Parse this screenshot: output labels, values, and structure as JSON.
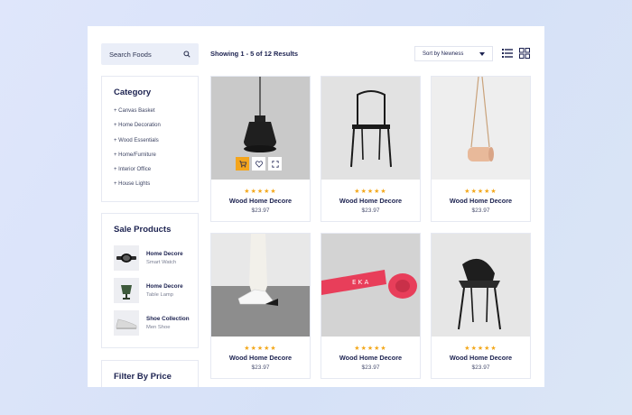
{
  "search": {
    "label": "Search Foods"
  },
  "category": {
    "title": "Category",
    "items": [
      "+ Canvas Basket",
      "+ Home Decoration",
      "+ Wood Essentials",
      "+ Home/Furniture",
      "+ Interior Office",
      "+ House Lights"
    ]
  },
  "sale": {
    "title": "Sale Products",
    "items": [
      {
        "title": "Home Decore",
        "sub": "Smart Watch",
        "icon": "watch-icon"
      },
      {
        "title": "Home Decore",
        "sub": "Table Lamp",
        "icon": "lamp-icon"
      },
      {
        "title": "Shoe Collection",
        "sub": "Men Shoe",
        "icon": "shoe-icon"
      }
    ]
  },
  "filter": {
    "title": "Filter By Price"
  },
  "header": {
    "showing": "Showing 1 - 5 of 12  Results",
    "sort_label": "Sort by Newness"
  },
  "products": [
    {
      "image": "pendant-lamp",
      "rating": "★★★★★",
      "name": "Wood Home Decore",
      "price": "$23.97"
    },
    {
      "image": "black-stool-chair",
      "rating": "★★★★★",
      "name": "Wood Home Decore",
      "price": "$23.97"
    },
    {
      "image": "hanging-bag",
      "rating": "★★★★★",
      "name": "Wood Home Decore",
      "price": "$23.97"
    },
    {
      "image": "sneakers",
      "rating": "★★★★★",
      "name": "Wood Home Decore",
      "price": "$23.97"
    },
    {
      "image": "red-tape",
      "rating": "★★★★★",
      "name": "Wood Home Decore",
      "price": "$23.97"
    },
    {
      "image": "black-chair",
      "rating": "★★★★★",
      "name": "Wood Home Decore",
      "price": "$23.97"
    }
  ],
  "colors": {
    "accent": "#f4a51c",
    "navy": "#1c2250",
    "search_bg": "#eaeef8"
  }
}
